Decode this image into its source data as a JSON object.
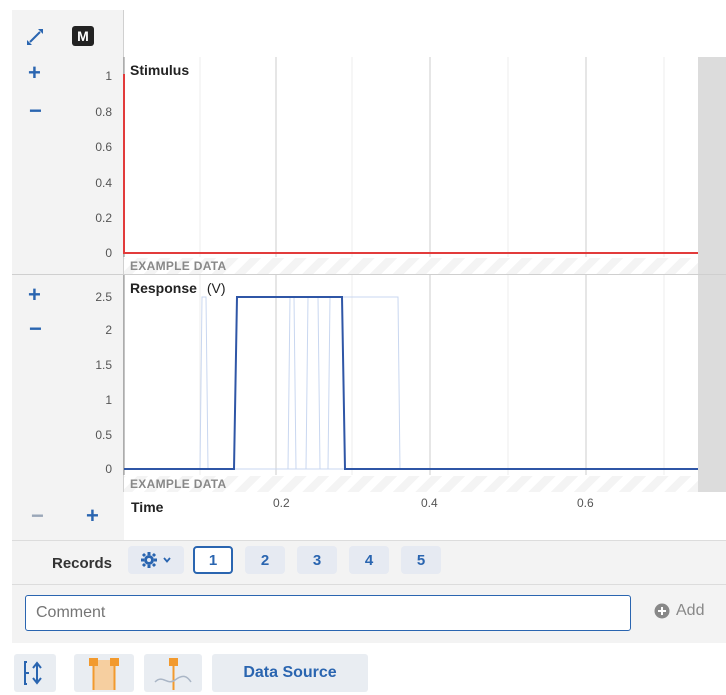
{
  "toolbar": {
    "expand_icon": "expand-diagonal-icon",
    "mode_badge": "M"
  },
  "stimulus": {
    "title": "Stimulus",
    "watermark": "EXAMPLE DATA",
    "y_ticks": [
      "1",
      "0.8",
      "0.6",
      "0.4",
      "0.2",
      "0"
    ]
  },
  "response": {
    "title": "Response",
    "unit": "(V)",
    "watermark": "EXAMPLE DATA",
    "y_ticks": [
      "2.5",
      "2",
      "1.5",
      "1",
      "0.5",
      "0"
    ]
  },
  "time_axis": {
    "label": "Time",
    "ticks": [
      "0.2",
      "0.4",
      "0.6"
    ]
  },
  "records": {
    "label": "Records",
    "items": [
      "1",
      "2",
      "3",
      "4",
      "5"
    ],
    "selected": "1"
  },
  "comment": {
    "placeholder": "Comment",
    "add_label": "Add"
  },
  "bottom_toolbar": {
    "data_source_label": "Data Source"
  },
  "colors": {
    "accent": "#2a65b0",
    "stimulus_line": "#e23b3b",
    "response_line": "#2f56a6"
  },
  "chart_data": [
    {
      "type": "line",
      "title": "Stimulus",
      "xlabel": "Time",
      "ylim": [
        0,
        1
      ],
      "xlim": [
        0,
        0.75
      ],
      "series": [
        {
          "values": [
            [
              0,
              1
            ],
            [
              0.001,
              0
            ],
            [
              0.75,
              0
            ]
          ]
        }
      ]
    },
    {
      "type": "line",
      "title": "Response",
      "ylabel": "(V)",
      "xlabel": "Time",
      "ylim": [
        0,
        2.5
      ],
      "xlim": [
        0,
        0.75
      ],
      "series": [
        {
          "values": [
            [
              0,
              0
            ],
            [
              0.14,
              0
            ],
            [
              0.145,
              2.5
            ],
            [
              0.285,
              2.5
            ],
            [
              0.29,
              0
            ],
            [
              0.75,
              0
            ]
          ]
        }
      ]
    }
  ]
}
